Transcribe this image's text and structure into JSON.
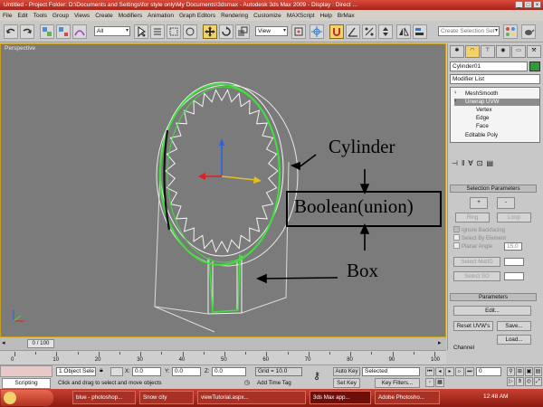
{
  "window": {
    "title": "Untitled    - Project Folder: D:\\Documents and Settings\\for style only\\My Documents\\3dsmax     - Autodesk 3ds Max  2009     - Display : Direct ..."
  },
  "menu": [
    "File",
    "Edit",
    "Tools",
    "Group",
    "Views",
    "Create",
    "Modifiers",
    "Animation",
    "Graph Editors",
    "Rendering",
    "Customize",
    "MAXScript",
    "Help",
    "BrMax"
  ],
  "toolbar": {
    "selection_filter": "All",
    "reference_coord": "View",
    "named_selection_placeholder": "Create Selection Set"
  },
  "viewport": {
    "label": "Perspective",
    "annotations": {
      "cylinder": "Cylinder",
      "boolean": "Boolean(union)",
      "box": "Box"
    }
  },
  "command_panel": {
    "object_name": "Cylinder01",
    "object_color": "#2e9a3a",
    "modifier_list": "Modifier List",
    "stack": [
      {
        "label": "MeshSmooth",
        "selected": false,
        "indent": 0
      },
      {
        "label": "Unwrap UVW",
        "selected": true,
        "indent": 0
      },
      {
        "label": "Vertex",
        "selected": false,
        "indent": 1
      },
      {
        "label": "Edge",
        "selected": false,
        "indent": 1
      },
      {
        "label": "Face",
        "selected": false,
        "indent": 1
      },
      {
        "label": "Editable Poly",
        "selected": false,
        "indent": 0
      }
    ],
    "selection_params": {
      "title": "Selection Parameters",
      "plus": "+",
      "minus": "-",
      "ring": "Ring",
      "loop": "Loop",
      "ignore_backfacing": "Ignore Backfacing",
      "select_by_element": "Select By Element",
      "planar_angle": "Planar Angle",
      "planar_angle_value": "15.0",
      "select_matid": "Select MatID",
      "select_sg": "Select SG"
    },
    "parameters": {
      "title": "Parameters",
      "edit": "Edit...",
      "reset_uvws": "Reset UVW's",
      "save": "Save...",
      "load": "Load...",
      "channel": "Channel"
    }
  },
  "timeline": {
    "frame": "0 / 100",
    "ticks": [
      "0",
      "10",
      "20",
      "30",
      "40",
      "50",
      "60",
      "70",
      "80",
      "90",
      "100"
    ]
  },
  "status": {
    "selected_count": "1 Object Sele",
    "x_label": "X:",
    "x_value": "0.0",
    "y_label": "Y:",
    "y_value": "0.0",
    "z_label": "Z:",
    "z_value": "0.0",
    "grid": "Grid = 10.0",
    "prompt": "Click and drag to select and move objects",
    "add_time_tag": "Add Time Tag",
    "auto_key": "Auto Key",
    "set_key": "Set Key",
    "key_mode": "Selected",
    "key_filters": "Key Filters...",
    "current_frame": "0",
    "scripting": "Scripting"
  },
  "taskbar": {
    "items": [
      {
        "label": "blue - photoshop...",
        "active": false
      },
      {
        "label": "Snow city",
        "active": false
      },
      {
        "label": "viewTutorial.aspx...",
        "active": false
      },
      {
        "label": "3ds Max app...",
        "active": true
      },
      {
        "label": "Adobe Photosho...",
        "active": false
      }
    ],
    "clock": "12:48 AM"
  },
  "colors": {
    "title_bar": "#c0392b",
    "viewport_bg": "#7b7b7b",
    "selected_wire": "#3ee03a",
    "active_tool": "#f2d36b"
  }
}
